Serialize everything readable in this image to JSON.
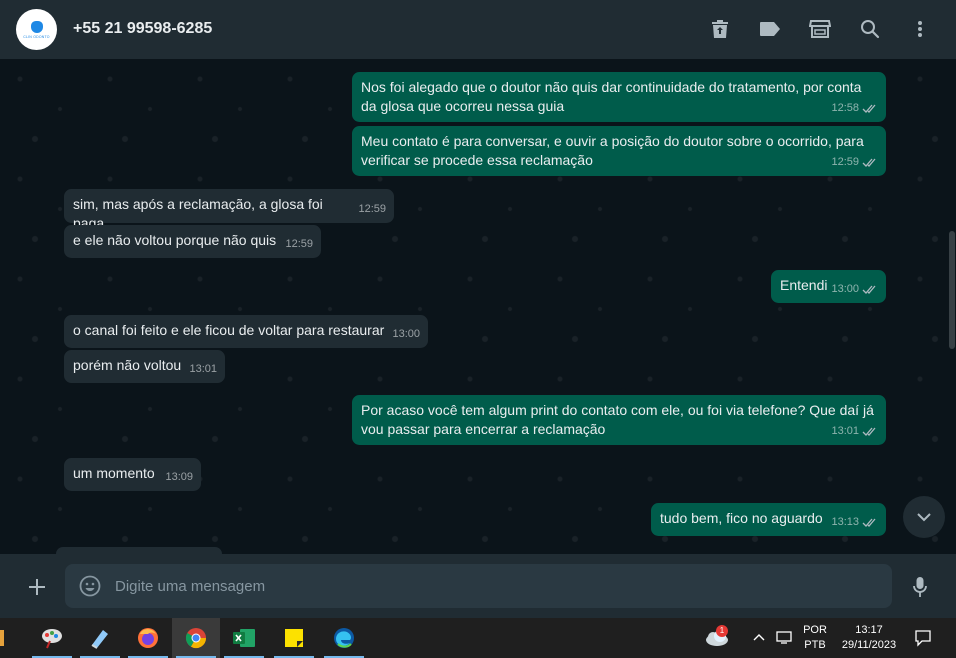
{
  "header": {
    "contact_name": "+55 21 99598-6285",
    "avatar_brand": "CLIN ODONTO",
    "icons": [
      "delete-icon",
      "label-icon",
      "store-icon",
      "search-icon",
      "menu-icon"
    ]
  },
  "messages": [
    {
      "direction": "out",
      "text": "Nos foi alegado que o doutor não quis dar continuidade do tratamento, por conta da glosa que ocorreu nessa guia",
      "time": "12:58",
      "status": "read"
    },
    {
      "direction": "out",
      "text": "Meu contato é para conversar, e ouvir a posição do doutor sobre o ocorrido, para verificar se procede essa reclamação",
      "time": "12:59",
      "status": "read"
    },
    {
      "direction": "in",
      "text": "sim, mas após a reclamação, a glosa foi paga",
      "time": "12:59"
    },
    {
      "direction": "in",
      "text": "e ele não voltou porque não quis",
      "time": "12:59"
    },
    {
      "direction": "out",
      "text": "Entendi",
      "time": "13:00",
      "status": "read"
    },
    {
      "direction": "in",
      "text": "o canal foi feito e ele ficou de voltar para restaurar",
      "time": "13:00"
    },
    {
      "direction": "in",
      "text": "porém não voltou",
      "time": "13:01"
    },
    {
      "direction": "out",
      "text": "Por acaso você tem algum print do contato com ele, ou foi via telefone? Que daí já vou passar para encerrar a reclamação",
      "time": "13:01",
      "status": "read"
    },
    {
      "direction": "in",
      "text": "um momento",
      "time": "13:09"
    },
    {
      "direction": "out",
      "text": "tudo bem, fico no aguardo",
      "time": "13:13",
      "status": "read"
    }
  ],
  "composer": {
    "placeholder": "Digite uma mensagem"
  },
  "taskbar": {
    "apps": [
      "app-icon",
      "paint-icon",
      "notepad-icon",
      "firefox-icon",
      "chrome-icon",
      "excel-icon",
      "sticky-notes-icon",
      "edge-icon"
    ],
    "weather_badge": "1",
    "language": "POR",
    "keyboard": "PTB",
    "time": "13:17",
    "date": "29/11/2023"
  },
  "colors": {
    "outgoing": "#005c4b",
    "incoming": "#202c33",
    "background": "#0b141a",
    "header": "#202c33"
  }
}
